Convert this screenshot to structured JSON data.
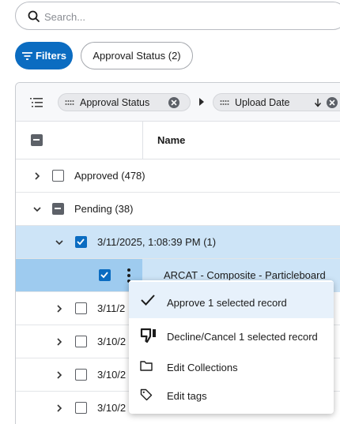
{
  "search": {
    "placeholder": "Search..."
  },
  "filters": {
    "label": "Filters"
  },
  "active_filter": {
    "label": "Approval Status (2)"
  },
  "group_by": {
    "chips": [
      {
        "label": "Approval Status"
      },
      {
        "label": "Upload Date"
      }
    ]
  },
  "columns": {
    "name": "Name"
  },
  "rows": [
    {
      "label": "Approved (478)",
      "checkbox": "unchecked"
    },
    {
      "label": "Pending (38)",
      "checkbox": "indeterminate"
    },
    {
      "label": "3/11/2025, 1:08:39 PM (1)",
      "checkbox": "checked"
    },
    {
      "label": "ARCAT - Composite - Particleboard",
      "checkbox": "checked"
    },
    {
      "label": "3/11/2"
    },
    {
      "label": "3/10/2"
    },
    {
      "label": "3/10/2"
    },
    {
      "label": "3/10/2"
    }
  ],
  "context_menu": {
    "items": [
      {
        "label": "Approve 1 selected record",
        "icon": "checkmark-icon"
      },
      {
        "label": "Decline/Cancel 1 selected record",
        "icon": "thumbs-down-icon"
      },
      {
        "label": "Edit Collections",
        "icon": "folder-icon"
      },
      {
        "label": "Edit tags",
        "icon": "tag-icon"
      }
    ]
  },
  "colors": {
    "accent": "#0b6cc1",
    "selected_row": "#cde4f7",
    "selected_row_dark": "#9ecbef"
  }
}
